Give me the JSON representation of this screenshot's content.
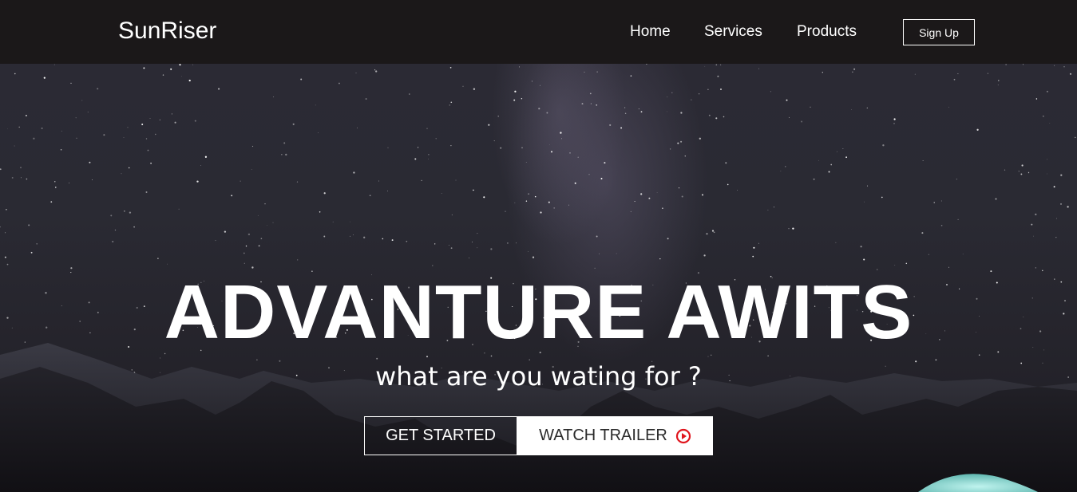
{
  "navbar": {
    "logo": "SunRiser",
    "links": [
      "Home",
      "Services",
      "Products"
    ],
    "signup_label": "Sign Up"
  },
  "hero": {
    "title": "ADVANTURE AWITS",
    "subtitle": "what are you wating for ?",
    "get_started_label": "GET STARTED",
    "watch_trailer_label": "WATCH TRAILER",
    "play_icon": "play-circle-icon"
  },
  "colors": {
    "navbar_bg": "#1b1819",
    "play_icon": "#e0151d",
    "text": "#ffffff"
  }
}
